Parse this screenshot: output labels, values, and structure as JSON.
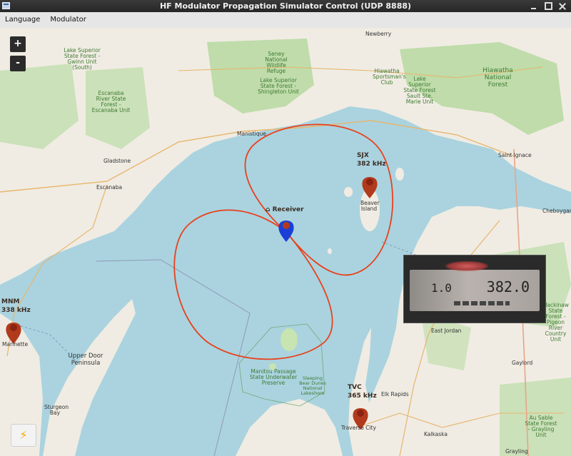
{
  "window": {
    "title": "HF Modulator Propagation Simulator Control (UDP 8888)"
  },
  "menu": {
    "items": [
      "Language",
      "Modulator"
    ]
  },
  "map_controls": {
    "zoom_in": "+",
    "zoom_out": "-"
  },
  "receiver": {
    "label": "Receiver",
    "icon": "house-icon",
    "pin_color": "#1a3fd6"
  },
  "stations": [
    {
      "id": "SJX",
      "freq": "382 kHz"
    },
    {
      "id": "MNM",
      "freq": "338 kHz"
    },
    {
      "id": "TVC",
      "freq": "365 kHz"
    }
  ],
  "radio_display": {
    "left_value": "1.0",
    "right_value": "382.0"
  },
  "pattern_color": "#e8411c",
  "station_pin_color": "#b23a1c",
  "action_button": {
    "icon": "lightning-icon",
    "glyph": "⚡"
  },
  "map_labels": [
    "Newberry",
    "Lake Superior State Forest - Gwinn Unit (South)",
    "Seney National Wildlife Refuge",
    "Lake Superior State Forest - Shingleton Unit",
    "Hiawatha Sportsman's Club",
    "Lake Superior State Forest Sault Ste. Marie Unit",
    "Hiawatha National Forest",
    "Escanaba River State Forest - Escanaba Unit",
    "Manistique",
    "Gladstone",
    "Escanaba",
    "Saint Ignace",
    "Cheboygan",
    "Beaver Island",
    "Mackinaw State Forest - Pigeon River Country Unit",
    "East Jordan",
    "Gaylord",
    "Marinette",
    "Upper Door Peninsula",
    "Sturgeon Bay",
    "Manitou Passage State Underwater Preserve",
    "Sleeping Bear Dunes National Lakeshore",
    "Elk Rapids",
    "Traverse City",
    "Kalkaska",
    "Au Sable State Forest - Grayling Unit",
    "Grayling"
  ]
}
